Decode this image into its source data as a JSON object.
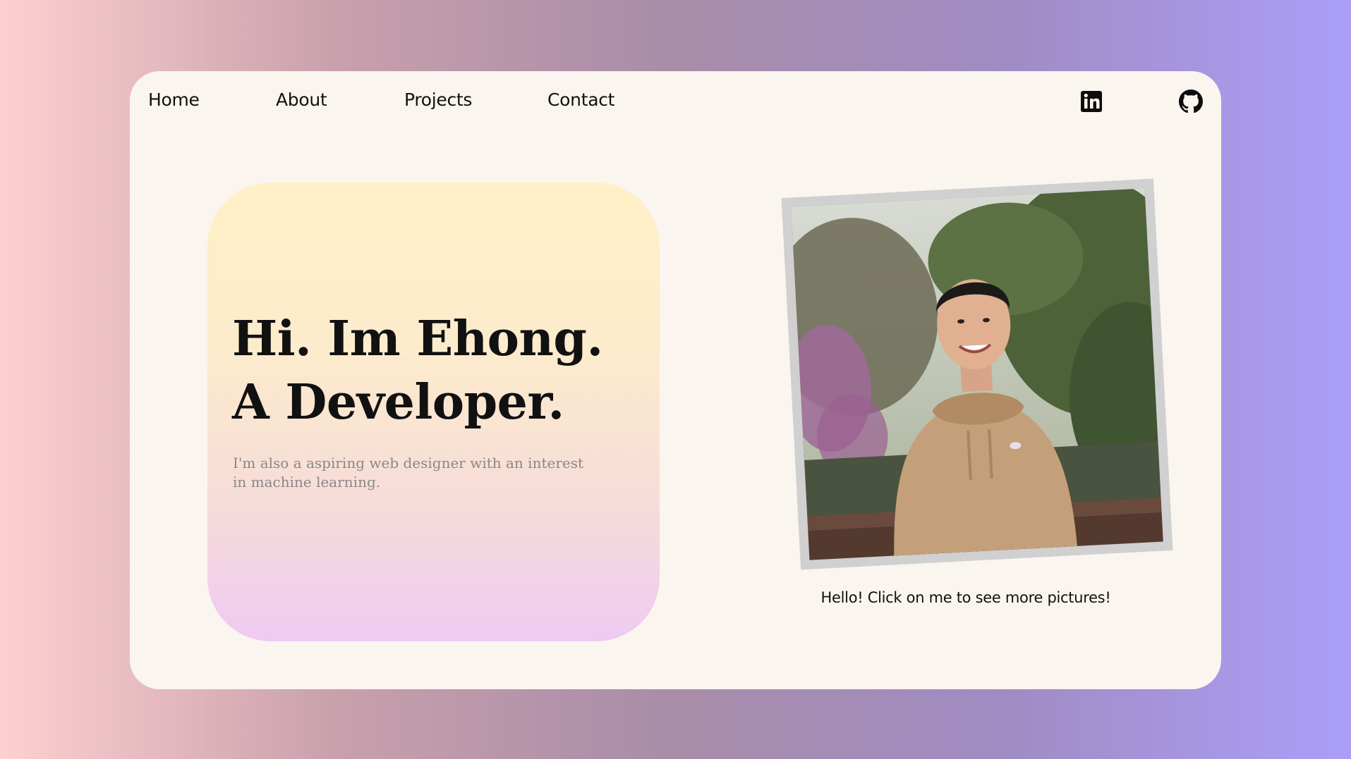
{
  "nav": {
    "home": "Home",
    "about": "About",
    "projects": "Projects",
    "contact": "Contact"
  },
  "social": {
    "linkedin_icon": "linkedin-icon",
    "github_icon": "github-icon"
  },
  "hero": {
    "title_line1": "Hi. Im Ehong.",
    "title_line2": "A Developer.",
    "subtitle": "I'm also a aspiring web designer with an interest in machine learning."
  },
  "photo": {
    "caption": "Hello! Click on me to see more pictures!"
  },
  "colors": {
    "card_bg": "#fbf5ef",
    "text": "#111111",
    "subtitle": "#888888",
    "frame": "#d0d0d0"
  }
}
